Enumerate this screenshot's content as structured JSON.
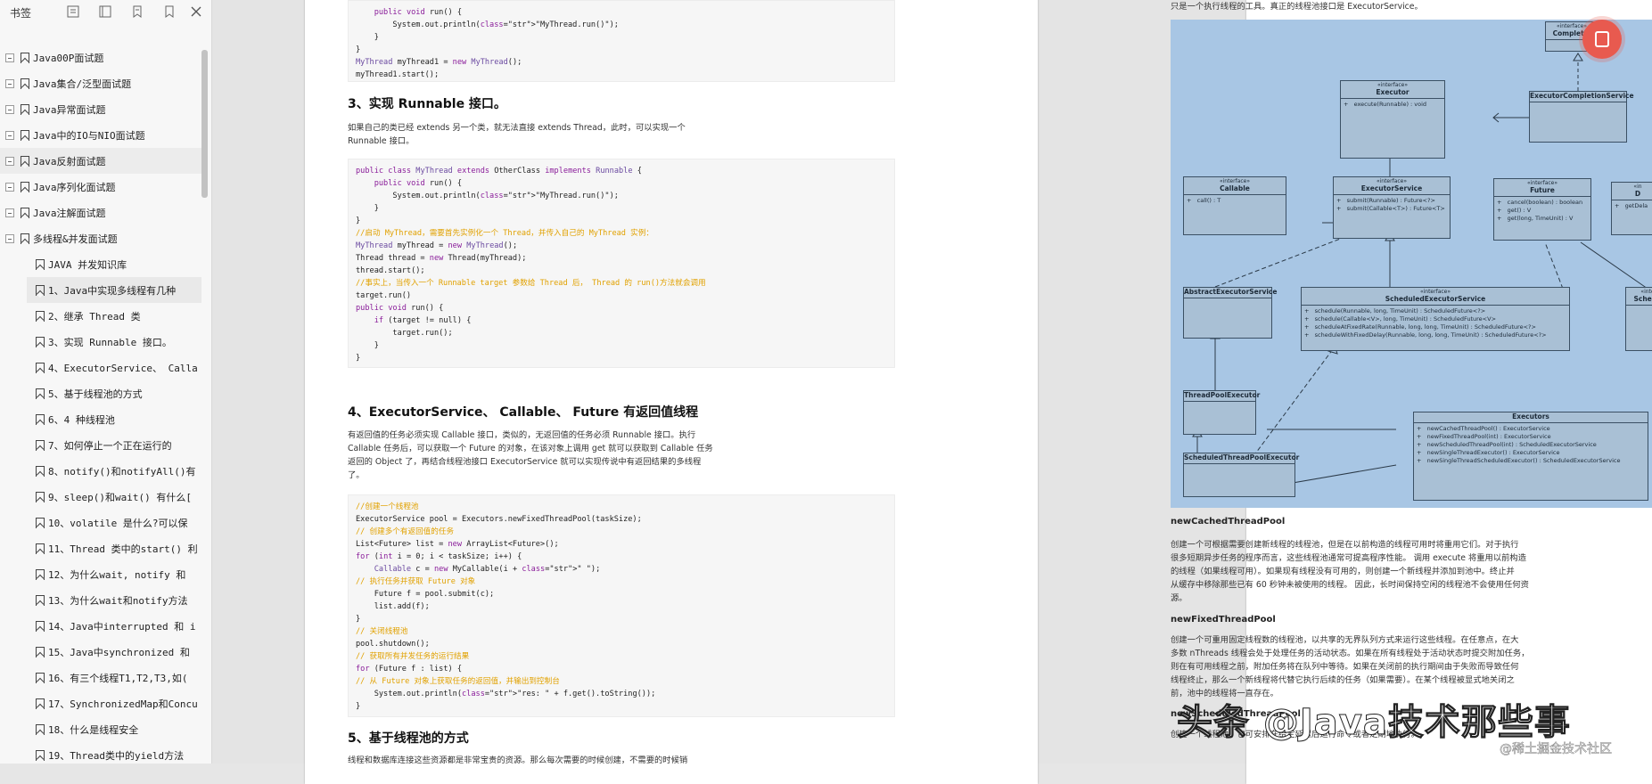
{
  "sidebar": {
    "title": "书签",
    "items": [
      {
        "label": "Java00P面试题",
        "level": 0
      },
      {
        "label": "Java集合/泛型面试题",
        "level": 0
      },
      {
        "label": "Java异常面试题",
        "level": 0
      },
      {
        "label": "Java中的IO与NIO面试题",
        "level": 0
      },
      {
        "label": "Java反射面试题",
        "level": 0
      },
      {
        "label": "Java序列化面试题",
        "level": 0
      },
      {
        "label": "Java注解面试题",
        "level": 0
      },
      {
        "label": "多线程&并发面试题",
        "level": 0
      },
      {
        "label": "JAVA 并发知识库",
        "level": 1
      },
      {
        "label": "1、Java中实现多线程有几种",
        "level": 1
      },
      {
        "label": "2、继承 Thread 类",
        "level": 1
      },
      {
        "label": "3、实现 Runnable 接口。",
        "level": 1
      },
      {
        "label": "4、ExecutorService、 Calla",
        "level": 1
      },
      {
        "label": "5、基于线程池的方式",
        "level": 1
      },
      {
        "label": "6、4 种线程池",
        "level": 1
      },
      {
        "label": "7、如何停止一个正在运行的",
        "level": 1
      },
      {
        "label": "8、notify()和notifyAll()有",
        "level": 1
      },
      {
        "label": "9、sleep()和wait() 有什么[",
        "level": 1
      },
      {
        "label": "10、volatile 是什么?可以保",
        "level": 1
      },
      {
        "label": "11、Thread 类中的start() 利",
        "level": 1
      },
      {
        "label": "12、为什么wait, notify 和",
        "level": 1
      },
      {
        "label": "13、为什么wait和notify方法",
        "level": 1
      },
      {
        "label": "14、Java中interrupted 和 i",
        "level": 1
      },
      {
        "label": "15、Java中synchronized 和",
        "level": 1
      },
      {
        "label": "16、有三个线程T1,T2,T3,如(",
        "level": 1
      },
      {
        "label": "17、SynchronizedMap和Concu",
        "level": 1
      },
      {
        "label": "18、什么是线程安全",
        "level": 1
      },
      {
        "label": "19、Thread类中的yield方法",
        "level": 1
      }
    ]
  },
  "page1": {
    "code1": [
      "    public void run() {",
      "        System.out.println(\"MyThread.run()\");",
      "    }",
      "}",
      "MyThread myThread1 = new MyThread();",
      "myThread1.start();"
    ],
    "h3_title": "3、实现 Runnable 接口。",
    "p3": [
      "如果自己的类已经 extends 另一个类，就无法直接 extends Thread，此时，可以实现一个",
      "Runnable 接口。"
    ],
    "code2": [
      "public class MyThread extends OtherClass implements Runnable {",
      "    public void run() {",
      "        System.out.println(\"MyThread.run()\");",
      "    }",
      "}",
      "//启动 MyThread，需要首先实例化一个 Thread，并传入自己的 MyThread 实例：",
      "MyThread myThread = new MyThread();",
      "Thread thread = new Thread(myThread);",
      "thread.start();",
      "//事实上，当传入一个 Runnable target 参数给 Thread 后， Thread 的 run()方法就会调用",
      "target.run()",
      "public void run() {",
      "    if (target != null) {",
      "        target.run();",
      "    }",
      "}"
    ],
    "h4_title": "4、ExecutorService、 Callable、 Future 有返回值线程",
    "p4": [
      "有返回值的任务必须实现 Callable 接口，类似的，无返回值的任务必须 Runnable 接口。执行",
      "Callable 任务后，可以获取一个 Future 的对象，在该对象上调用 get 就可以获取到 Callable 任务",
      "返回的 Object 了，再结合线程池接口 ExecutorService 就可以实现传说中有返回结果的多线程",
      "了。"
    ],
    "code3": [
      "//创建一个线程池",
      "ExecutorService pool = Executors.newFixedThreadPool(taskSize);",
      "// 创建多个有返回值的任务",
      "List<Future> list = new ArrayList<Future>();",
      "for (int i = 0; i < taskSize; i++) {",
      "    Callable c = new MyCallable(i + \" \");",
      "// 执行任务并获取 Future 对象",
      "    Future f = pool.submit(c);",
      "    list.add(f);",
      "}",
      "// 关闭线程池",
      "pool.shutdown();",
      "// 获取所有并发任务的运行结果",
      "for (Future f : list) {",
      "// 从 Future 对象上获取任务的返回值，并输出到控制台",
      "    System.out.println(\"res: \" + f.get().toString());",
      "}"
    ],
    "h5_title": "5、基于线程池的方式",
    "p5": "线程和数据库连接这些资源都是非常宝贵的资源。那么每次需要的时候创建，不需要的时候销"
  },
  "page2": {
    "top_line": "只是一个执行线程的工具。真正的线程池接口是 ExecutorService。",
    "s1_title": "newCachedThreadPool",
    "s1_text": [
      "创建一个可根据需要创建新线程的线程池，但是在以前构造的线程可用时将重用它们。对于执行",
      "很多短期异步任务的程序而言，这些线程池通常可提高程序性能。 调用 execute 将重用以前构造",
      "的线程（如果线程可用）。如果现有线程没有可用的，则创建一个新线程并添加到池中。终止并",
      "从缓存中移除那些已有 60 秒钟未被使用的线程。 因此，长时间保持空闲的线程池不会使用任何资",
      "源。"
    ],
    "s2_title": "newFixedThreadPool",
    "s2_text": [
      "创建一个可重用固定线程数的线程池，以共享的无界队列方式来运行这些线程。在任意点，在大",
      "多数 nThreads 线程会处于处理任务的活动状态。如果在所有线程处于活动状态时提交附加任务，",
      "则在有可用线程之前，附加任务将在队列中等待。如果在关闭前的执行期间由于失败而导致任何",
      "线程终止，那么一个新线程将代替它执行后续的任务（如果需要）。在某个线程被显式地关闭之",
      "前，池中的线程将一直存在。"
    ],
    "s3_title": "newScheduledThreadPool",
    "s3_text": "创建一个线程池，它可安排在给定延迟后运行命令或者定期地执行。"
  },
  "diagram": {
    "boxes": [
      {
        "st": "«interface»",
        "nm": "Executor",
        "mb": "+   execute(Runnable) : void"
      },
      {
        "st": "",
        "nm": "ExecutorCompletionService",
        "mb": ""
      },
      {
        "st": "«interface»",
        "nm": "Completio",
        "mb": ""
      },
      {
        "st": "«interface»",
        "nm": "Callable",
        "mb": "+   call() : T"
      },
      {
        "st": "«interface»",
        "nm": "ExecutorService",
        "mb": "+   submit(Runnable) : Future<?>\n+   submit(Callable<T>) : Future<T>"
      },
      {
        "st": "«interface»",
        "nm": "Future",
        "mb": "+   cancel(boolean) : boolean\n+   get() : V\n+   get(long, TimeUnit) : V"
      },
      {
        "st": "«in",
        "nm": "D",
        "mb": "+   getDela"
      },
      {
        "st": "",
        "nm": "AbstractExecutorService",
        "mb": ""
      },
      {
        "st": "«interface»",
        "nm": "ScheduledExecutorService",
        "mb": "+   schedule(Runnable, long, TimeUnit) : ScheduledFuture<?>\n+   schedule(Callable<V>, long, TimeUnit) : ScheduledFuture<V>\n+   scheduleAtFixedRate(Runnable, long, long, TimeUnit) : ScheduledFuture<?>\n+   scheduleWithFixedDelay(Runnable, long, long, TimeUnit) : ScheduledFuture<?>"
      },
      {
        "st": "«inte",
        "nm": "Schedu",
        "mb": ""
      },
      {
        "st": "",
        "nm": "ThreadPoolExecutor",
        "mb": ""
      },
      {
        "st": "",
        "nm": "Executors",
        "mb": "+   newCachedThreadPool() : ExecutorService\n+   newFixedThreadPool(int) : ExecutorService\n+   newScheduledThreadPool(int) : ScheduledExecutorService\n+   newSingleThreadExecutor() : ExecutorService\n+   newSingleThreadScheduledExecutor() : ScheduledExecutorService"
      },
      {
        "st": "",
        "nm": "ScheduledThreadPoolExecutor",
        "mb": ""
      }
    ]
  },
  "watermark": {
    "main": "头条 @Java技术那些事",
    "small": "@稀土掘金技术社区"
  },
  "colors": {
    "diagram_bg": "#a8c6e4",
    "badge": "#e85a4f",
    "keyword": "#8a1d9a",
    "comment": "#e1a100"
  }
}
